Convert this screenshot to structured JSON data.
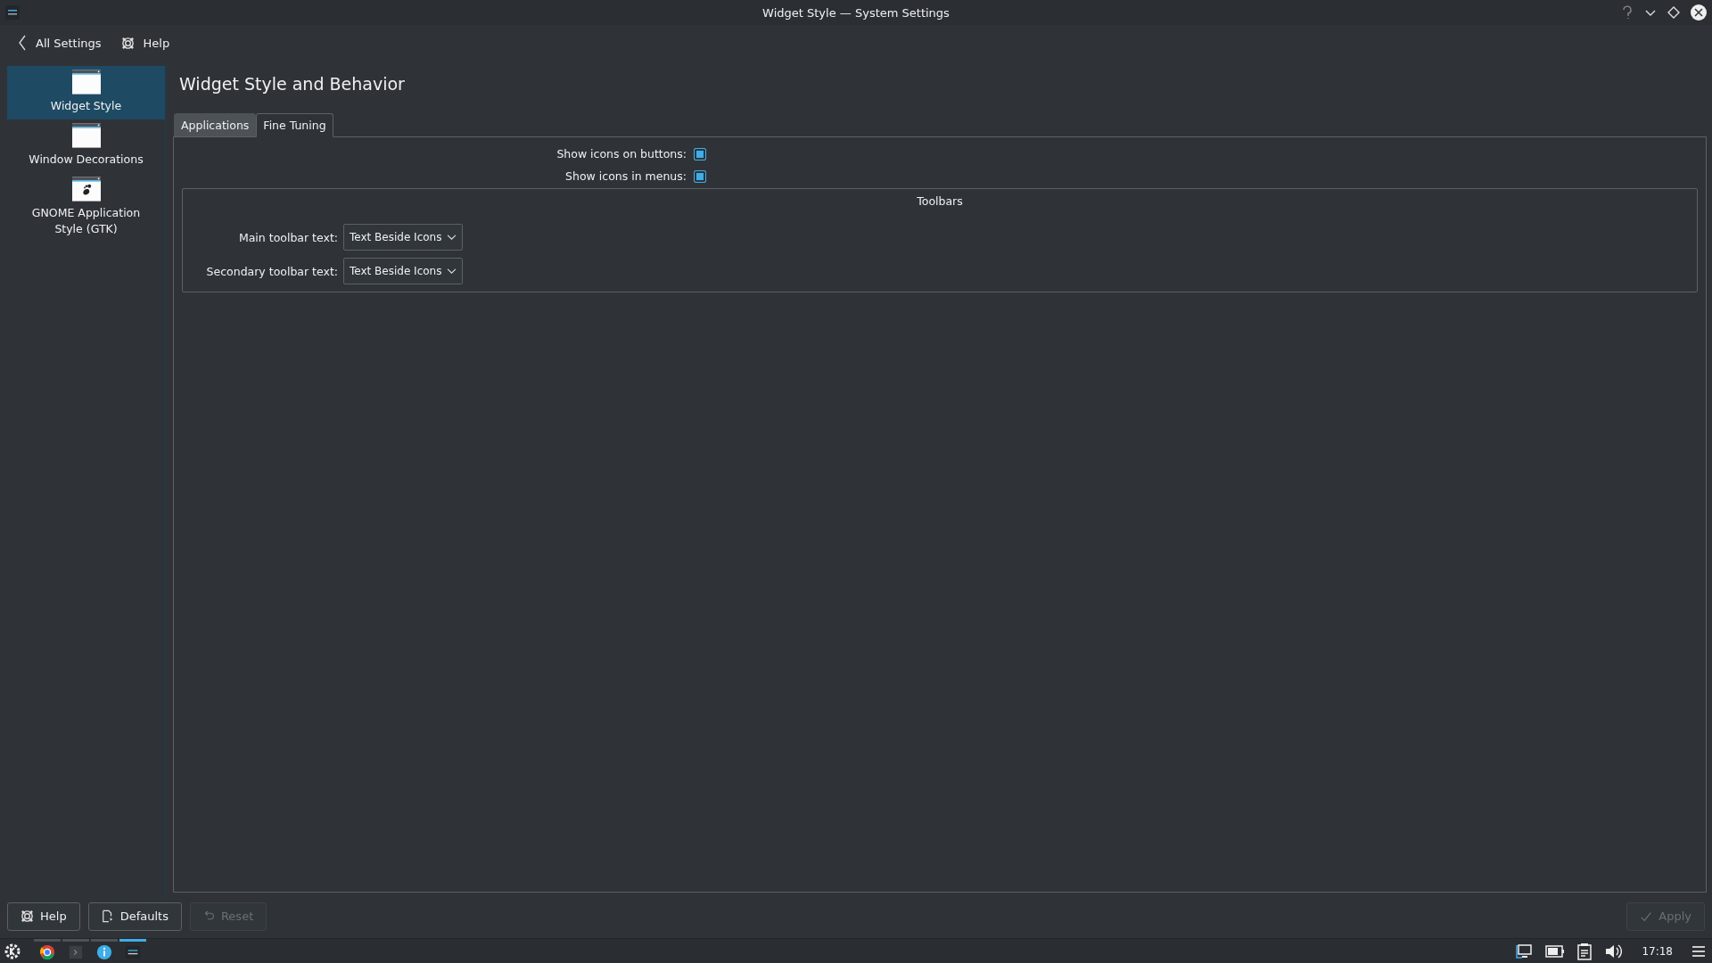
{
  "window": {
    "title": "Widget Style — System Settings"
  },
  "toolbar": [
    {
      "kind": "back",
      "label": "All Settings"
    },
    {
      "kind": "help",
      "label": "Help"
    }
  ],
  "sidebar": {
    "items": [
      {
        "label": "Widget Style",
        "kind": "window",
        "selected": true
      },
      {
        "label": "Window Decorations",
        "kind": "window",
        "selected": false
      },
      {
        "label": "GNOME Application Style (GTK)",
        "kind": "gtk",
        "selected": false
      }
    ]
  },
  "heading": "Widget Style and Behavior",
  "tabs": [
    {
      "label": "Applications",
      "selected": false
    },
    {
      "label": "Fine Tuning",
      "selected": true
    }
  ],
  "checkboxes": [
    {
      "label": "Show icons on buttons:",
      "checked": true
    },
    {
      "label": "Show icons in menus:",
      "checked": true
    }
  ],
  "group": {
    "title": "Toolbars",
    "rows": [
      {
        "label": "Main toolbar text:",
        "value": "Text Beside Icons"
      },
      {
        "label": "Secondary toolbar text:",
        "value": "Text Beside Icons"
      }
    ]
  },
  "buttons": [
    {
      "kind": "help",
      "label": "Help",
      "disabled": false
    },
    {
      "kind": "defaults",
      "label": "Defaults",
      "disabled": false
    },
    {
      "kind": "reset",
      "label": "Reset",
      "disabled": true
    },
    {
      "kind": "apply",
      "label": "Apply",
      "disabled": true
    }
  ],
  "taskbar": {
    "tasks": [
      {
        "kind": "browser",
        "selected": false
      },
      {
        "kind": "terminal",
        "selected": false
      },
      {
        "kind": "info",
        "selected": false
      },
      {
        "kind": "settings",
        "selected": true
      }
    ],
    "clock": "17:18"
  }
}
